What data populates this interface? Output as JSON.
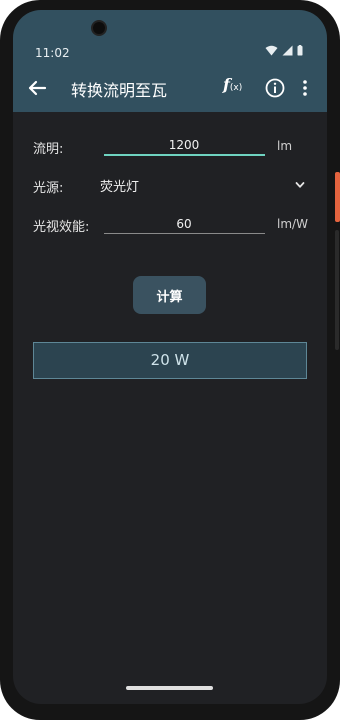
{
  "status_bar": {
    "time": "11:02"
  },
  "app_bar": {
    "title": "转换流明至瓦",
    "fx_label": "f",
    "fx_sub": "(x)"
  },
  "form": {
    "lumens": {
      "label": "流明:",
      "value": "1200",
      "unit": "lm"
    },
    "light_source": {
      "label": "光源:",
      "selected": "荧光灯"
    },
    "efficacy": {
      "label": "光视效能:",
      "value": "60",
      "unit": "lm/W"
    }
  },
  "calculate_button": {
    "label": "计算"
  },
  "result": {
    "text": "20 W"
  },
  "colors": {
    "app_bar": "#32505f",
    "accent_underline": "#6fd3c0",
    "background": "#202124",
    "result_bg": "#2c4450"
  }
}
